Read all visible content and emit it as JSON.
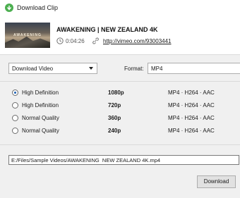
{
  "window": {
    "title": "Download Clip",
    "app_icon": "4k-video-downloader-icon",
    "accent_color": "#4caf50"
  },
  "video": {
    "title": "AWAKENING | NEW ZEALAND 4K",
    "duration": "0:04:26",
    "url": "http://vimeo.com/93003441",
    "thumbnail_text": "AWAKENING"
  },
  "options": {
    "download_type": "Download Video",
    "format_label": "Format:",
    "format_value": "MP4"
  },
  "qualities": [
    {
      "label": "High Definition",
      "resolution": "1080p",
      "codec": "MP4 · H264 · AAC",
      "selected": true
    },
    {
      "label": "High Definition",
      "resolution": "720p",
      "codec": "MP4 · H264 · AAC",
      "selected": false
    },
    {
      "label": "Normal Quality",
      "resolution": "360p",
      "codec": "MP4 · H264 · AAC",
      "selected": false
    },
    {
      "label": "Normal Quality",
      "resolution": "240p",
      "codec": "MP4 · H264 · AAC",
      "selected": false
    }
  ],
  "save_path": "E:/Files/Sample Videos/AWAKENING  NEW ZEALAND 4K.mp4",
  "download_label": "Download"
}
